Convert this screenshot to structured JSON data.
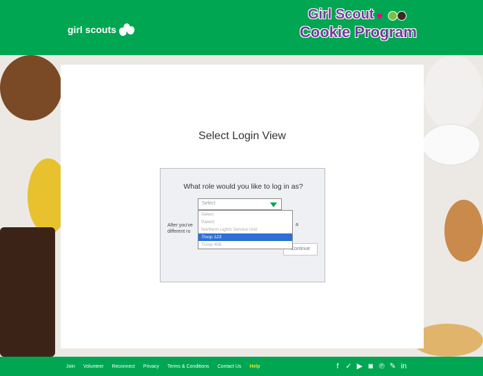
{
  "header": {
    "gs_logo_text": "girl scouts",
    "program_logo": {
      "line1": "Girl Scout",
      "line2": "Cookie Program"
    }
  },
  "login": {
    "title": "Select Login View",
    "question": "What role would you like to log in as?",
    "select": {
      "value": "Select",
      "options": [
        "Select",
        "Parent",
        "Northern Lights Service Unit",
        "Troop 123",
        "Troop 456"
      ],
      "highlighted_index": 3
    },
    "hint_start": "After you've different ro",
    "hint_end": "a",
    "continue_label": "Continue"
  },
  "footer": {
    "links": [
      "Join",
      "Volunteer",
      "Reconnect",
      "Privacy",
      "Terms & Conditions",
      "Contact Us",
      "Help"
    ],
    "social_icons": [
      "facebook-icon",
      "twitter-icon",
      "youtube-icon",
      "instagram-icon",
      "pinterest-icon",
      "blog-icon",
      "linkedin-icon"
    ]
  },
  "colors": {
    "brand_green": "#00a651",
    "purple": "#6d3f97",
    "pink": "#ec008c",
    "help_yellow": "#f4e12b",
    "selection_blue": "#2c6fd6"
  }
}
